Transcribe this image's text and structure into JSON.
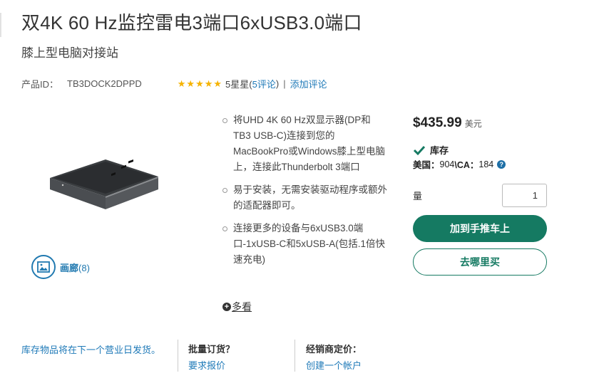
{
  "product": {
    "title": "双4K 60 Hz监控雷电3端口6xUSB3.0端口",
    "subtitle": "膝上型电脑对接站",
    "id_label": "产品ID：",
    "id_value": "TB3DOCK2DPPD",
    "rating_stars": 5,
    "rating_text": "5星星(",
    "rating_count_link": "5评论",
    "rating_close": ")",
    "separator": "|",
    "add_review": "添加评论"
  },
  "gallery": {
    "label": "画廊",
    "count": "(8)"
  },
  "features": [
    "将UHD 4K 60 Hz双显示器(DP和TB3 USB-C)连接到您的MacBookPro或Windows膝上型电脑上，连接此Thunderbolt 3端口",
    "易于安装，无需安装驱动程序或额外的适配器即可。",
    "连接更多的设备与6xUSB3.0端口-1xUSB-C和5xUSB-A(包括.1倍快速充电)"
  ],
  "more_link": "多看",
  "buybox": {
    "price": "$435.99",
    "currency": "美元",
    "stock_label": "库存",
    "stock_detail_prefix": "美国：",
    "stock_detail_us": "904",
    "stock_detail_ca_label": "\\CA：",
    "stock_detail_ca": "184",
    "qty_label": "量",
    "qty_value": "1",
    "add_to_cart": "加到手推车上",
    "where_to_buy": "去哪里买",
    "accent_color": "#157a62"
  },
  "footer": {
    "shipping_note": "库存物品将在下一个营业日发货。",
    "bulk_heading": "批量订货？",
    "bulk_link": "要求报价",
    "reseller_heading": "经销商定价：",
    "reseller_link": "创建一个帐户"
  }
}
